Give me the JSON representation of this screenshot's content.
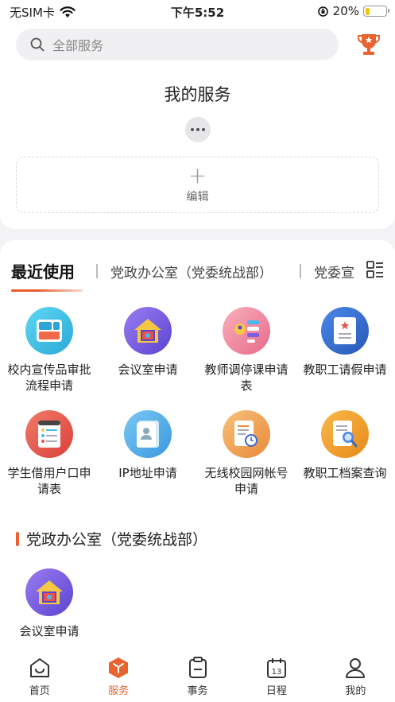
{
  "status_bar": {
    "carrier": "无SIM卡",
    "time": "下午5:52",
    "battery": "20%",
    "battery_level": 0.2
  },
  "search": {
    "placeholder": "全部服务"
  },
  "my_services": {
    "title": "我的服务",
    "edit_label": "编辑"
  },
  "tabs": {
    "active": "最近使用",
    "items": [
      "党政办公室（党委统战部）",
      "党委宣"
    ]
  },
  "recent_apps": [
    {
      "label": "校内宣传品审批流程申请",
      "icon": "board-icon",
      "color": "#3fc4e8"
    },
    {
      "label": "会议室申请",
      "icon": "house-icon",
      "color": "#7b5ee6"
    },
    {
      "label": "教师调停课申请表",
      "icon": "schedule-icon",
      "color": "#f08ca0"
    },
    {
      "label": "教职工请假申请",
      "icon": "doc-star-icon",
      "color": "#3b6fd6"
    },
    {
      "label": "学生借用户口申请表",
      "icon": "list-icon",
      "color": "#e8524a"
    },
    {
      "label": "IP地址申请",
      "icon": "id-card-icon",
      "color": "#4aa8e8"
    },
    {
      "label": "无线校园网帐号申请",
      "icon": "doc-clock-icon",
      "color": "#f0a04a"
    },
    {
      "label": "教职工档案查询",
      "icon": "search-doc-icon",
      "color": "#f0a030"
    }
  ],
  "group": {
    "title": "党政办公室（党委统战部）",
    "apps": [
      {
        "label": "会议室申请",
        "icon": "house-icon",
        "color": "#7b5ee6"
      }
    ]
  },
  "bottom_nav": [
    {
      "label": "首页",
      "icon": "home-icon"
    },
    {
      "label": "服务",
      "icon": "service-icon",
      "active": true
    },
    {
      "label": "事务",
      "icon": "clipboard-icon"
    },
    {
      "label": "日程",
      "icon": "calendar-icon"
    },
    {
      "label": "我的",
      "icon": "profile-icon"
    }
  ],
  "colors": {
    "accent": "#e8632f"
  }
}
